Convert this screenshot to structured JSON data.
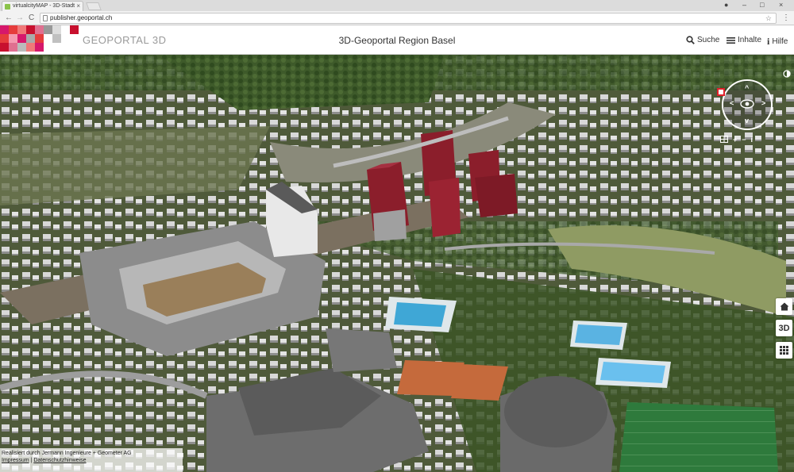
{
  "browser": {
    "tab_title": "virtualcityMAP - 3D-Stadt",
    "tab_close": "×",
    "url": "publisher.geoportal.ch",
    "back": "←",
    "forward": "→",
    "reload": "C",
    "menu": "⋮",
    "minimize": "–",
    "maximize": "□",
    "close": "×",
    "profile": "●"
  },
  "header": {
    "logo_text": "GEOPORTAL 3D",
    "title": "3D-Geoportal Region Basel",
    "search_label": "Suche",
    "contents_label": "Inhalte",
    "help_label": "Hilfe"
  },
  "map_controls": {
    "home_icon": "⌂",
    "mode_label": "3D",
    "grid_icon": "⊞",
    "compass_north": "^",
    "compass_south": "v",
    "compass_west": "<",
    "compass_east": ">",
    "zoom_in": "+",
    "zoom_out": "−",
    "tilt": "i"
  },
  "footer": {
    "credit": "Realisiert durch Jermann Ingenieure + Geometer AG",
    "impressum": "Impressum",
    "separator": "|",
    "privacy": "Datenschutzhinweise"
  }
}
